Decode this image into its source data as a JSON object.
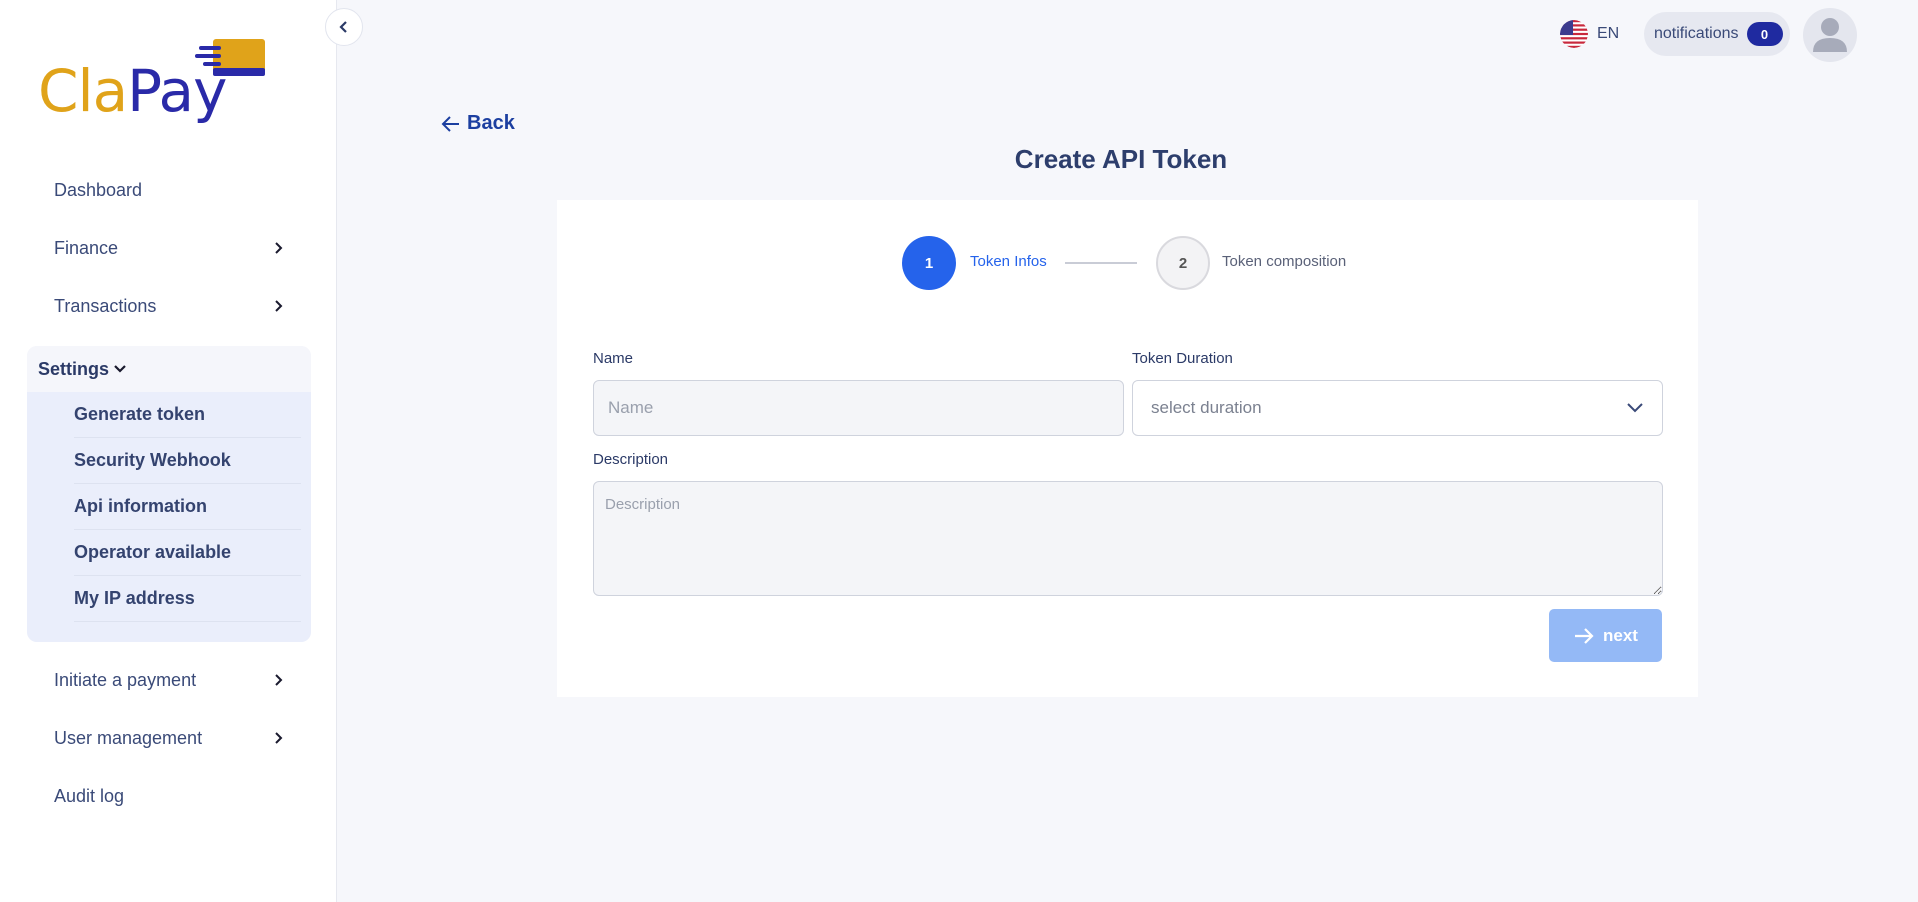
{
  "brand": {
    "logo_part1": "Cla",
    "logo_part2": "Pay",
    "color_primary": "#2a2aa8",
    "color_accent": "#e0a31a"
  },
  "sidebar": {
    "items": [
      {
        "label": "Dashboard",
        "icon": "none"
      },
      {
        "label": "Finance",
        "icon": "chevron-right-icon"
      },
      {
        "label": "Transactions",
        "icon": "chevron-right-icon"
      }
    ],
    "settings": {
      "label": "Settings",
      "icon": "chevron-down-icon",
      "sub_items": [
        {
          "label": "Generate token"
        },
        {
          "label": "Security Webhook"
        },
        {
          "label": "Api information"
        },
        {
          "label": "Operator available"
        },
        {
          "label": "My IP address"
        }
      ]
    },
    "items_after": [
      {
        "label": "Initiate a payment",
        "icon": "chevron-right-icon"
      },
      {
        "label": "User management",
        "icon": "chevron-right-icon"
      },
      {
        "label": "Audit log",
        "icon": "none"
      }
    ]
  },
  "header": {
    "language": "EN",
    "language_icon": "us-flag-icon",
    "notifications_label": "notifications",
    "notifications_count": "0",
    "avatar_icon": "user-avatar-icon"
  },
  "main": {
    "back_label": "Back",
    "title": "Create API Token",
    "steps": [
      {
        "number": "1",
        "label": "Token Infos",
        "active": true
      },
      {
        "number": "2",
        "label": "Token composition",
        "active": false
      }
    ],
    "form": {
      "name_label": "Name",
      "name_placeholder": "Name",
      "duration_label": "Token Duration",
      "duration_placeholder": "select duration",
      "description_label": "Description",
      "description_placeholder": "Description",
      "next_label": "next"
    }
  },
  "colors": {
    "step_active": "#2563eb",
    "next_button": "#94b9f6",
    "badge": "#1f2aa0"
  }
}
